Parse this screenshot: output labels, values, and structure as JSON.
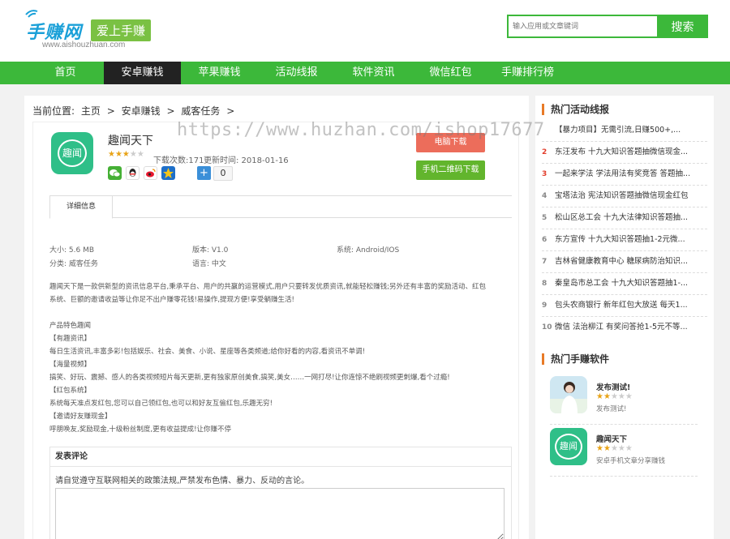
{
  "header": {
    "logo_text": "手赚网",
    "logo_badge": "爱上手赚",
    "logo_url": "www.aishouzhuan.com",
    "search_placeholder": "输入应用或文章键词",
    "search_button": "搜索"
  },
  "nav": [
    {
      "label": "首页",
      "active": false
    },
    {
      "label": "安卓赚钱",
      "active": true
    },
    {
      "label": "苹果赚钱",
      "active": false
    },
    {
      "label": "活动线报",
      "active": false
    },
    {
      "label": "软件资讯",
      "active": false
    },
    {
      "label": "微信红包",
      "active": false
    },
    {
      "label": "手赚排行榜",
      "active": false
    }
  ],
  "breadcrumb": {
    "prefix": "当前位置:",
    "items": [
      "主页",
      ">",
      "安卓赚钱",
      ">",
      "威客任务",
      ">"
    ]
  },
  "app": {
    "icon_text": "趣闻",
    "name": "趣闻天下",
    "rating": 3,
    "downloads": "下载次数:171",
    "updated": "更新时间: 2018-01-16",
    "share_count": "0",
    "pc_download": "电脑下载",
    "qr_download": "手机二维码下载"
  },
  "tabs": {
    "active": "详细信息"
  },
  "info": {
    "size": "大小: 5.6 MB",
    "version": "版本: V1.0",
    "system": "系统: Android/IOS",
    "category": "分类: 威客任务",
    "language": "语言: 中文"
  },
  "description": {
    "intro_1": "趣闻天下是一款供新型的资讯信息平台,秉承平台、用户的共赢的运营模式,用户只要转发优质资讯,就能轻松赚钱;另外还有丰富的奖励活动、红包",
    "intro_2": "系统、巨额的邀请收益等让你足不出户赚零花钱!易操作,提现方便!享受躺赚生活!",
    "features_title": "产品特色趣闻",
    "f1_title": "【有趣资讯】",
    "f1_text": "每日生活资讯,丰富多彩!包括娱乐、社会、美食、小说、星座等各类频道;给你好看的内容,看资讯不单调!",
    "f2_title": "【海量视频】",
    "f2_text": "搞笑、好玩、震撼、感人的各类视频短片每天更新,更有独家原创美食,搞笑,美女……一网打尽!让你连惊不绝刷视频更刺爆,看个过瘾!",
    "f3_title": "【红包系统】",
    "f3_text": "系统每天准点发红包,您可以自己领红包,也可以和好友互偷红包,乐趣无穷!",
    "f4_title": "【邀请好友赚现金】",
    "f4_text": "呼朋唤友,奖励现金,十级粉丝制度,更有收益提成!让你赚不停"
  },
  "comment": {
    "title": "发表评论",
    "hint": "请自觉遵守互联网相关的政策法规,严禁发布色情、暴力、反动的言论。"
  },
  "sidebar": {
    "hot_title": "热门活动线报",
    "hot_items": [
      {
        "num": "",
        "text": "【暴力项目】无需引流,日赚500+,..."
      },
      {
        "num": "2",
        "text": "东汪发布 十九大知识答题抽微信现金..."
      },
      {
        "num": "3",
        "text": "一起来学法 学法用法有奖竞答 答题抽..."
      },
      {
        "num": "4",
        "text": "宝塔法治 宪法知识答题抽微信现金红包"
      },
      {
        "num": "5",
        "text": "松山区总工会 十九大法律知识答题抽..."
      },
      {
        "num": "6",
        "text": "东方宣传 十九大知识答题抽1-2元微..."
      },
      {
        "num": "7",
        "text": "吉林省健康教育中心 糖尿病防治知识..."
      },
      {
        "num": "8",
        "text": "秦皇岛市总工会 十九大知识答题抽1-..."
      },
      {
        "num": "9",
        "text": "包头农商银行 新年红包大放送 每天1..."
      },
      {
        "num": "10",
        "text": "微信 法治柳江 有奖问答抢1-5元不等..."
      }
    ],
    "soft_title": "热门手赚软件",
    "soft_items": [
      {
        "name": "发布测试!",
        "rating": 2,
        "desc": "发布测试!"
      },
      {
        "name": "趣闻天下",
        "rating": 2,
        "desc": "安卓手机文章分享赚钱",
        "icon_text": "趣闻"
      }
    ]
  },
  "watermark": "https://www.huzhan.com/ishop17677",
  "colors": {
    "brand_green": "#3cb83a",
    "nav_active": "#222222",
    "pc_button": "#ec6d5b",
    "qr_button": "#62b52d",
    "app_icon": "#2fbf88",
    "accent_orange": "#e87a27",
    "rank_red": "#e23c2a"
  }
}
